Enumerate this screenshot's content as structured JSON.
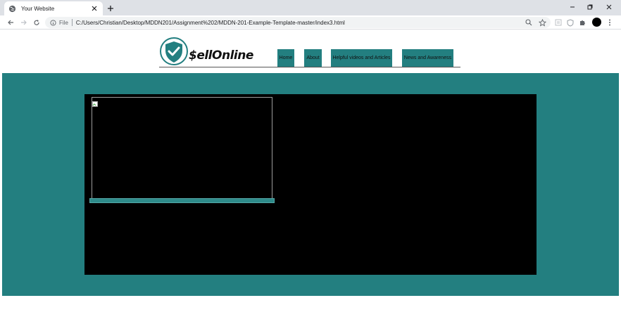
{
  "browser": {
    "tab_title": "Your Website",
    "omnibox_scheme_label": "File",
    "url": "C:/Users/Christian/Desktop/MDDN201/Assignment%202/MDDN-201-Example-Template-master/index3.html"
  },
  "site": {
    "brand": "$ellOnline",
    "nav": [
      {
        "label": "Home"
      },
      {
        "label": "About"
      },
      {
        "label": "Helpful videos and Articles"
      },
      {
        "label": "News and Awareness"
      }
    ]
  },
  "colors": {
    "accent_teal": "#237f80",
    "panel_black": "#000000"
  },
  "icons": [
    "globe-icon",
    "close-icon",
    "plus-icon",
    "minimize-icon",
    "restore-icon",
    "back-arrow-icon",
    "forward-arrow-icon",
    "reload-icon",
    "info-icon",
    "zoom-icon",
    "star-icon",
    "reader-icon",
    "shield-extension-icon",
    "puzzle-icon",
    "menu-dots-icon",
    "shield-check-logo-icon",
    "broken-image-icon"
  ]
}
